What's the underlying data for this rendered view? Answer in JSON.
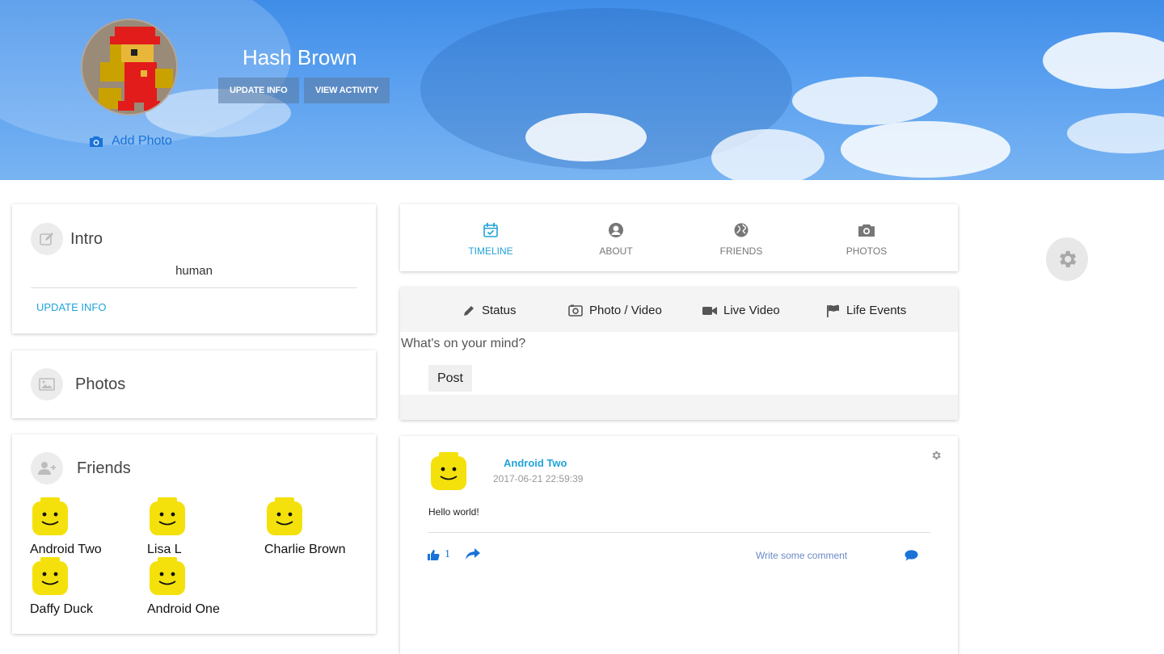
{
  "profile": {
    "name": "Hash Brown",
    "add_photo_label": "Add Photo",
    "update_info_label": "UPDATE INFO",
    "view_activity_label": "VIEW ACTIVITY"
  },
  "intro": {
    "title": "Intro",
    "bio": "human",
    "update_info_link": "UPDATE INFO"
  },
  "photos": {
    "title": "Photos"
  },
  "friends": {
    "title": "Friends",
    "list": [
      {
        "name": "Android Two"
      },
      {
        "name": "Lisa L"
      },
      {
        "name": "Charlie Brown"
      },
      {
        "name": "Daffy Duck"
      },
      {
        "name": "Android One"
      }
    ]
  },
  "tabs": [
    {
      "label": "TIMELINE",
      "icon": "calendar-icon",
      "active": true
    },
    {
      "label": "ABOUT",
      "icon": "user-circle-icon",
      "active": false
    },
    {
      "label": "FRIENDS",
      "icon": "globe-icon",
      "active": false
    },
    {
      "label": "PHOTOS",
      "icon": "camera-icon",
      "active": false
    }
  ],
  "composer": {
    "types": [
      {
        "label": "Status",
        "icon": "pencil-icon"
      },
      {
        "label": "Photo / Video",
        "icon": "photo-camera-icon"
      },
      {
        "label": "Live Video",
        "icon": "video-camera-icon"
      },
      {
        "label": "Life Events",
        "icon": "flag-icon"
      }
    ],
    "placeholder": "What's on your mind?",
    "post_label": "Post"
  },
  "post": {
    "author": "Android Two",
    "timestamp": "2017-06-21 22:59:39",
    "text": "Hello world!",
    "like_count": "1",
    "comment_placeholder": "Write some comment"
  },
  "colors": {
    "accent": "#21a3d8",
    "link_blue": "#1a73d8",
    "lego_yellow": "#f4e10c"
  }
}
